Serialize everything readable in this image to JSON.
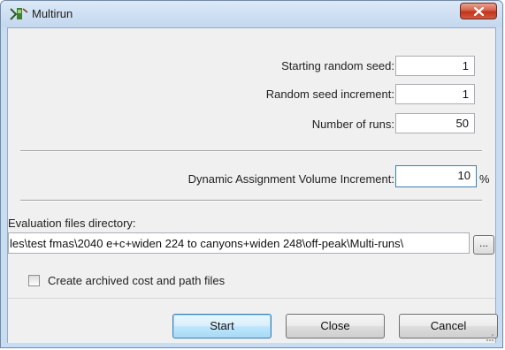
{
  "window": {
    "title": "Multirun"
  },
  "seed": {
    "label": "Starting random seed:",
    "value": "1"
  },
  "increment": {
    "label": "Random seed increment:",
    "value": "1"
  },
  "runs": {
    "label": "Number of runs:",
    "value": "50"
  },
  "dav": {
    "label": "Dynamic Assignment Volume Increment:",
    "value": "10",
    "unit": "%"
  },
  "eval": {
    "label": "Evaluation files directory:",
    "path": "les\\test fmas\\2040 e+c+widen 224 to canyons+widen 248\\off-peak\\Multi-runs\\",
    "browse_label": "..."
  },
  "archive": {
    "label": "Create archived cost and path files",
    "checked": false
  },
  "buttons": {
    "start": "Start",
    "close": "Close",
    "cancel": "Cancel"
  },
  "icons": {
    "app": "multirun-app-icon",
    "close": "close-icon",
    "resize": "resize-grip-icon"
  },
  "colors": {
    "close_button": "#c2331b",
    "title_bar": "#c9ddf2",
    "focus_border": "#3c7fb1"
  }
}
